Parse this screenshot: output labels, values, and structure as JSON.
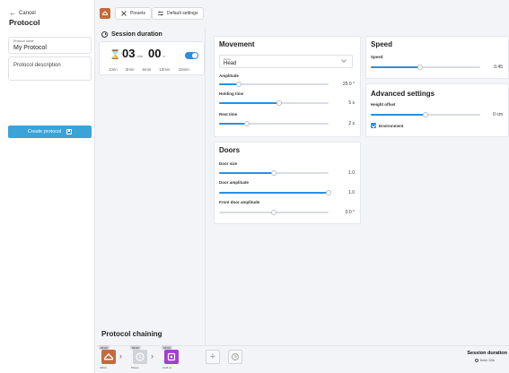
{
  "sidebar": {
    "cancel_label": "Cancel",
    "title": "Protocol",
    "name_field": {
      "label": "Protocol name",
      "value": "My Protocol"
    },
    "description_field": {
      "placeholder": "Protocol description"
    },
    "create_button": "Create protocol"
  },
  "toolbar": {
    "presets_label": "Presets",
    "defaults_label": "Default settings"
  },
  "session": {
    "title": "Session duration",
    "minutes": "03",
    "minutes_unit": "min.",
    "seconds": "00",
    "seconds_unit": "s",
    "enabled": true,
    "quick_durations": [
      "1min",
      "3min",
      "5min",
      "10min",
      "15min"
    ]
  },
  "movement": {
    "title": "Movement",
    "mode": {
      "label": "Mode",
      "value": "Head"
    },
    "amplitude": {
      "label": "Amplitude",
      "value": "25.0 °",
      "fraction": 0.18
    },
    "holding_time": {
      "label": "Holding time",
      "value": "5 s",
      "fraction": 0.55
    },
    "rest_time": {
      "label": "Rest time",
      "value": "2 s",
      "fraction": 0.25
    }
  },
  "doors": {
    "title": "Doors",
    "door_size": {
      "label": "Door size",
      "value": "1.0",
      "fraction": 0.5
    },
    "door_amplitude": {
      "label": "Door amplitude",
      "value": "1.0",
      "fraction": 1.0
    },
    "front_door_amplitude": {
      "label": "Front door amplitude",
      "value": "0.0 °",
      "fraction": 0.5
    }
  },
  "speed": {
    "title": "Speed",
    "speed": {
      "label": "Speed",
      "value": "0.45",
      "fraction": 0.45
    }
  },
  "advanced": {
    "title": "Advanced settings",
    "height_offset": {
      "label": "Height offset",
      "value": "0 cm",
      "fraction": 0.5
    },
    "environment": {
      "label": "Environment",
      "checked": true
    }
  },
  "chaining": {
    "title": "Protocol chaining",
    "items": [
      {
        "badge": "03:00",
        "name": "Inflow",
        "color": "#c46a3b"
      },
      {
        "badge": "00:30",
        "name": "Pause",
        "color": "#cfd3da"
      },
      {
        "badge": "03:00",
        "name": "Hold on",
        "color": "#a43dd6"
      }
    ],
    "summary_title": "Session duration",
    "summary_value": "6min 30s"
  },
  "colors": {
    "accent": "#2a8fe0",
    "button": "#3aa3d8"
  }
}
